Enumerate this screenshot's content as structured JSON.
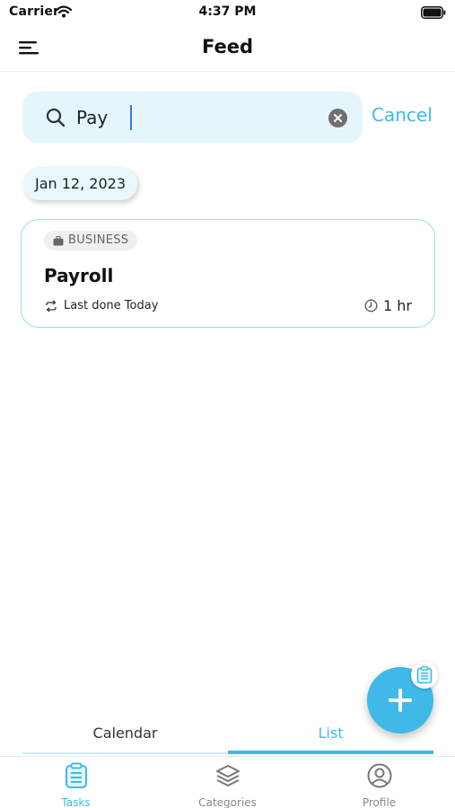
{
  "status_bar": {
    "carrier": "Carrier",
    "time": "4:37 PM"
  },
  "header": {
    "title": "Feed",
    "menu_icon": "hamburger-menu-icon"
  },
  "search": {
    "value": "Pay",
    "placeholder": "",
    "cancel_label": "Cancel"
  },
  "feed": {
    "date_label": "Jan 12, 2023",
    "tasks": [
      {
        "category": "BUSINESS",
        "category_icon": "briefcase-icon",
        "title": "Payroll",
        "last_done": "Last done Today",
        "duration": "1 hr"
      }
    ]
  },
  "view_toggle": {
    "calendar_label": "Calendar",
    "list_label": "List",
    "active": "List"
  },
  "tab_bar": {
    "items": [
      {
        "label": "Tasks",
        "icon": "clipboard-icon",
        "active": true
      },
      {
        "label": "Categories",
        "icon": "layers-icon",
        "active": false
      },
      {
        "label": "Profile",
        "icon": "profile-icon",
        "active": false
      }
    ]
  },
  "colors": {
    "accent": "#3dbbe6",
    "search_bg": "#e4f6fb",
    "card_border": "#9adcef",
    "fab": "#3fb9e8"
  }
}
